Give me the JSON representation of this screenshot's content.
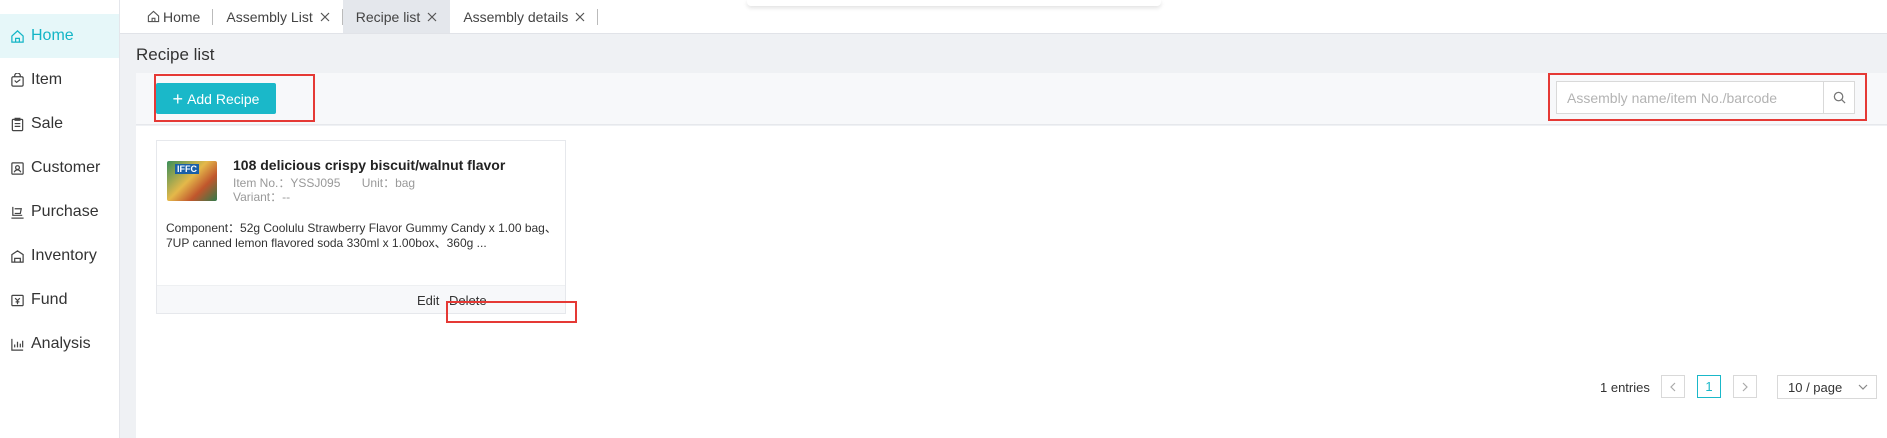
{
  "sidebar": {
    "items": [
      {
        "label": "Home",
        "icon": "home-icon",
        "active": true
      },
      {
        "label": "Item",
        "icon": "bag-icon"
      },
      {
        "label": "Sale",
        "icon": "clipboard-icon"
      },
      {
        "label": "Customer",
        "icon": "contact-card-icon"
      },
      {
        "label": "Purchase",
        "icon": "cart-icon"
      },
      {
        "label": "Inventory",
        "icon": "warehouse-icon"
      },
      {
        "label": "Fund",
        "icon": "wallet-icon"
      },
      {
        "label": "Analysis",
        "icon": "bar-chart-icon"
      }
    ]
  },
  "tabs": [
    {
      "label": "Home",
      "closable": false
    },
    {
      "label": "Assembly List",
      "closable": true
    },
    {
      "label": "Recipe list",
      "closable": true,
      "active": true
    },
    {
      "label": "Assembly details",
      "closable": true
    }
  ],
  "page": {
    "title": "Recipe list"
  },
  "toolbar": {
    "add_label": "Add Recipe",
    "search_placeholder": "Assembly name/item No./barcode"
  },
  "recipe_card": {
    "name": "108 delicious crispy biscuit/walnut flavor",
    "item_no": "Item No.：YSSJ095",
    "unit": "Unit：bag",
    "variant": "Variant：--",
    "component": "Component：52g Coolulu Strawberry Flavor Gummy Candy x 1.00 bag、7UP canned lemon flavored soda 330ml x 1.00box、360g ...",
    "thumb_brand": "IFFC",
    "edit_label": "Edit",
    "delete_label": "Delete"
  },
  "pagination": {
    "entries": "1 entries",
    "current_page": "1",
    "page_size": "10 / page"
  },
  "colors": {
    "accent": "#1ab8c9",
    "highlight": "#e53935"
  }
}
